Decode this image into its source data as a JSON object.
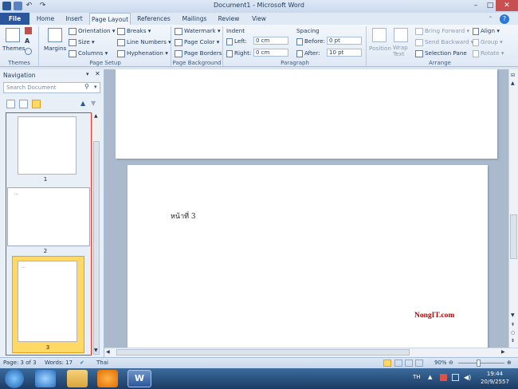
{
  "window": {
    "title": "Document1 - Microsoft Word"
  },
  "tabs": [
    {
      "label": "File"
    },
    {
      "label": "Home"
    },
    {
      "label": "Insert"
    },
    {
      "label": "Page Layout"
    },
    {
      "label": "References"
    },
    {
      "label": "Mailings"
    },
    {
      "label": "Review"
    },
    {
      "label": "View"
    }
  ],
  "ribbon": {
    "themes": {
      "label": "Themes",
      "group": "Themes"
    },
    "page_setup": {
      "margins": "Margins",
      "orientation": "Orientation",
      "size": "Size",
      "columns": "Columns",
      "breaks": "Breaks",
      "line_numbers": "Line Numbers",
      "hyphenation": "Hyphenation",
      "group": "Page Setup"
    },
    "page_background": {
      "watermark": "Watermark",
      "page_color": "Page Color",
      "page_borders": "Page Borders",
      "group": "Page Background"
    },
    "paragraph": {
      "indent": "Indent",
      "left_label": "Left:",
      "left_value": "0 cm",
      "right_label": "Right:",
      "right_value": "0 cm",
      "spacing": "Spacing",
      "before_label": "Before:",
      "before_value": "0 pt",
      "after_label": "After:",
      "after_value": "10 pt",
      "group": "Paragraph"
    },
    "arrange": {
      "position": "Position",
      "wrap_text": "Wrap Text",
      "bring_forward": "Bring Forward",
      "send_backward": "Send Backward",
      "selection_pane": "Selection Pane",
      "align": "Align",
      "group_btn": "Group",
      "rotate": "Rotate",
      "group": "Arrange"
    }
  },
  "navigation": {
    "title": "Navigation",
    "search_placeholder": "Search Document",
    "thumbnails": [
      {
        "number": "1"
      },
      {
        "number": "2"
      },
      {
        "number": "3"
      }
    ]
  },
  "document": {
    "page_text": "หน้าที่ 3",
    "watermark_text": "NongIT.com"
  },
  "status": {
    "page": "Page: 3 of 3",
    "words": "Words: 17",
    "language": "Thai",
    "zoom": "90%"
  },
  "taskbar": {
    "lang": "TH",
    "time": "19:44",
    "date": "20/9/2557"
  },
  "colors": {
    "file_tab": "#2b579a",
    "nav_border": "#e03c31",
    "watermark": "#c00000",
    "selected_thumb": "#ffd966"
  }
}
